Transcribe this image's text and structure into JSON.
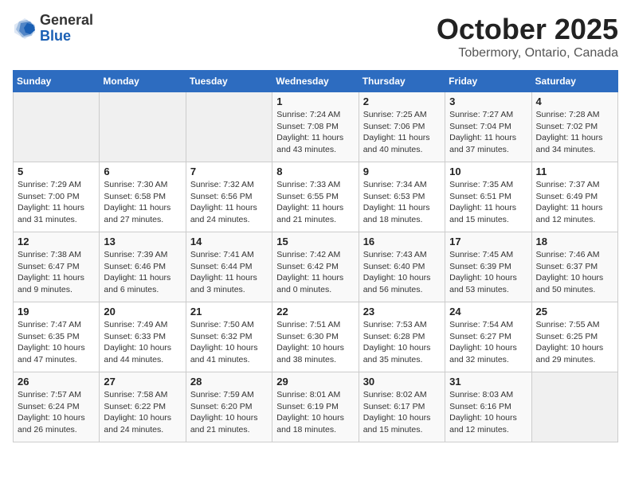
{
  "logo": {
    "general": "General",
    "blue": "Blue"
  },
  "title": "October 2025",
  "location": "Tobermory, Ontario, Canada",
  "weekdays": [
    "Sunday",
    "Monday",
    "Tuesday",
    "Wednesday",
    "Thursday",
    "Friday",
    "Saturday"
  ],
  "weeks": [
    [
      {
        "day": "",
        "sunrise": "",
        "sunset": "",
        "daylight": ""
      },
      {
        "day": "",
        "sunrise": "",
        "sunset": "",
        "daylight": ""
      },
      {
        "day": "",
        "sunrise": "",
        "sunset": "",
        "daylight": ""
      },
      {
        "day": "1",
        "sunrise": "Sunrise: 7:24 AM",
        "sunset": "Sunset: 7:08 PM",
        "daylight": "Daylight: 11 hours and 43 minutes."
      },
      {
        "day": "2",
        "sunrise": "Sunrise: 7:25 AM",
        "sunset": "Sunset: 7:06 PM",
        "daylight": "Daylight: 11 hours and 40 minutes."
      },
      {
        "day": "3",
        "sunrise": "Sunrise: 7:27 AM",
        "sunset": "Sunset: 7:04 PM",
        "daylight": "Daylight: 11 hours and 37 minutes."
      },
      {
        "day": "4",
        "sunrise": "Sunrise: 7:28 AM",
        "sunset": "Sunset: 7:02 PM",
        "daylight": "Daylight: 11 hours and 34 minutes."
      }
    ],
    [
      {
        "day": "5",
        "sunrise": "Sunrise: 7:29 AM",
        "sunset": "Sunset: 7:00 PM",
        "daylight": "Daylight: 11 hours and 31 minutes."
      },
      {
        "day": "6",
        "sunrise": "Sunrise: 7:30 AM",
        "sunset": "Sunset: 6:58 PM",
        "daylight": "Daylight: 11 hours and 27 minutes."
      },
      {
        "day": "7",
        "sunrise": "Sunrise: 7:32 AM",
        "sunset": "Sunset: 6:56 PM",
        "daylight": "Daylight: 11 hours and 24 minutes."
      },
      {
        "day": "8",
        "sunrise": "Sunrise: 7:33 AM",
        "sunset": "Sunset: 6:55 PM",
        "daylight": "Daylight: 11 hours and 21 minutes."
      },
      {
        "day": "9",
        "sunrise": "Sunrise: 7:34 AM",
        "sunset": "Sunset: 6:53 PM",
        "daylight": "Daylight: 11 hours and 18 minutes."
      },
      {
        "day": "10",
        "sunrise": "Sunrise: 7:35 AM",
        "sunset": "Sunset: 6:51 PM",
        "daylight": "Daylight: 11 hours and 15 minutes."
      },
      {
        "day": "11",
        "sunrise": "Sunrise: 7:37 AM",
        "sunset": "Sunset: 6:49 PM",
        "daylight": "Daylight: 11 hours and 12 minutes."
      }
    ],
    [
      {
        "day": "12",
        "sunrise": "Sunrise: 7:38 AM",
        "sunset": "Sunset: 6:47 PM",
        "daylight": "Daylight: 11 hours and 9 minutes."
      },
      {
        "day": "13",
        "sunrise": "Sunrise: 7:39 AM",
        "sunset": "Sunset: 6:46 PM",
        "daylight": "Daylight: 11 hours and 6 minutes."
      },
      {
        "day": "14",
        "sunrise": "Sunrise: 7:41 AM",
        "sunset": "Sunset: 6:44 PM",
        "daylight": "Daylight: 11 hours and 3 minutes."
      },
      {
        "day": "15",
        "sunrise": "Sunrise: 7:42 AM",
        "sunset": "Sunset: 6:42 PM",
        "daylight": "Daylight: 11 hours and 0 minutes."
      },
      {
        "day": "16",
        "sunrise": "Sunrise: 7:43 AM",
        "sunset": "Sunset: 6:40 PM",
        "daylight": "Daylight: 10 hours and 56 minutes."
      },
      {
        "day": "17",
        "sunrise": "Sunrise: 7:45 AM",
        "sunset": "Sunset: 6:39 PM",
        "daylight": "Daylight: 10 hours and 53 minutes."
      },
      {
        "day": "18",
        "sunrise": "Sunrise: 7:46 AM",
        "sunset": "Sunset: 6:37 PM",
        "daylight": "Daylight: 10 hours and 50 minutes."
      }
    ],
    [
      {
        "day": "19",
        "sunrise": "Sunrise: 7:47 AM",
        "sunset": "Sunset: 6:35 PM",
        "daylight": "Daylight: 10 hours and 47 minutes."
      },
      {
        "day": "20",
        "sunrise": "Sunrise: 7:49 AM",
        "sunset": "Sunset: 6:33 PM",
        "daylight": "Daylight: 10 hours and 44 minutes."
      },
      {
        "day": "21",
        "sunrise": "Sunrise: 7:50 AM",
        "sunset": "Sunset: 6:32 PM",
        "daylight": "Daylight: 10 hours and 41 minutes."
      },
      {
        "day": "22",
        "sunrise": "Sunrise: 7:51 AM",
        "sunset": "Sunset: 6:30 PM",
        "daylight": "Daylight: 10 hours and 38 minutes."
      },
      {
        "day": "23",
        "sunrise": "Sunrise: 7:53 AM",
        "sunset": "Sunset: 6:28 PM",
        "daylight": "Daylight: 10 hours and 35 minutes."
      },
      {
        "day": "24",
        "sunrise": "Sunrise: 7:54 AM",
        "sunset": "Sunset: 6:27 PM",
        "daylight": "Daylight: 10 hours and 32 minutes."
      },
      {
        "day": "25",
        "sunrise": "Sunrise: 7:55 AM",
        "sunset": "Sunset: 6:25 PM",
        "daylight": "Daylight: 10 hours and 29 minutes."
      }
    ],
    [
      {
        "day": "26",
        "sunrise": "Sunrise: 7:57 AM",
        "sunset": "Sunset: 6:24 PM",
        "daylight": "Daylight: 10 hours and 26 minutes."
      },
      {
        "day": "27",
        "sunrise": "Sunrise: 7:58 AM",
        "sunset": "Sunset: 6:22 PM",
        "daylight": "Daylight: 10 hours and 24 minutes."
      },
      {
        "day": "28",
        "sunrise": "Sunrise: 7:59 AM",
        "sunset": "Sunset: 6:20 PM",
        "daylight": "Daylight: 10 hours and 21 minutes."
      },
      {
        "day": "29",
        "sunrise": "Sunrise: 8:01 AM",
        "sunset": "Sunset: 6:19 PM",
        "daylight": "Daylight: 10 hours and 18 minutes."
      },
      {
        "day": "30",
        "sunrise": "Sunrise: 8:02 AM",
        "sunset": "Sunset: 6:17 PM",
        "daylight": "Daylight: 10 hours and 15 minutes."
      },
      {
        "day": "31",
        "sunrise": "Sunrise: 8:03 AM",
        "sunset": "Sunset: 6:16 PM",
        "daylight": "Daylight: 10 hours and 12 minutes."
      },
      {
        "day": "",
        "sunrise": "",
        "sunset": "",
        "daylight": ""
      }
    ]
  ]
}
